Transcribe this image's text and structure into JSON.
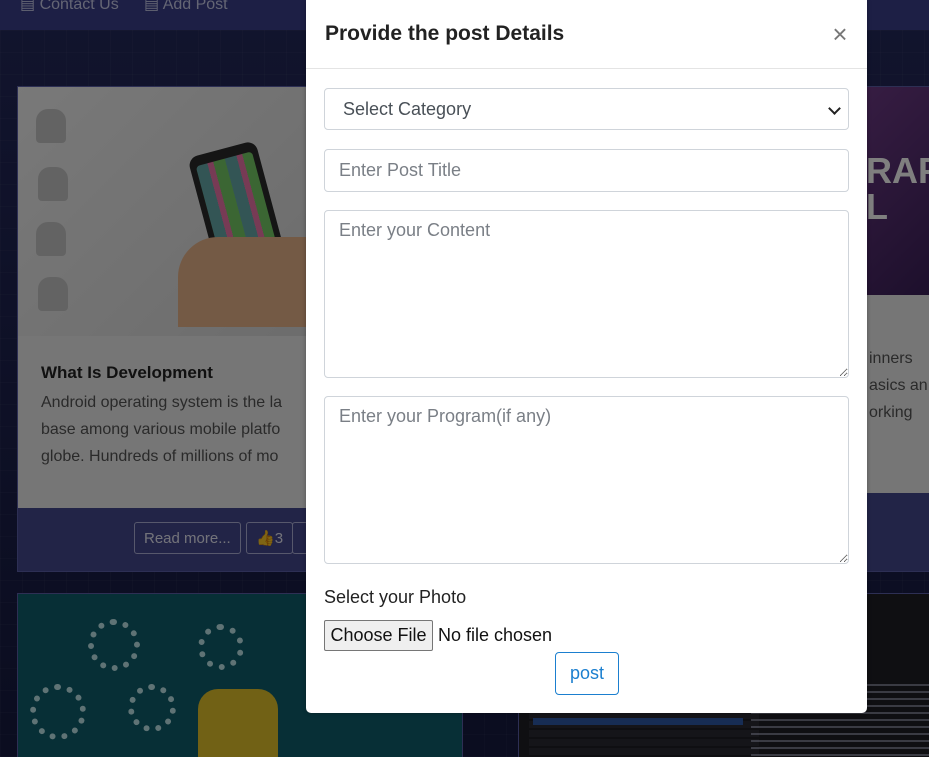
{
  "nav": {
    "contact": "Contact Us",
    "add_post": "Add Post"
  },
  "cards": {
    "card1": {
      "title": "What Is Development",
      "text": "Android operating system is the la\nbase among various mobile platfo\nglobe. Hundreds of millions of mo",
      "read_more": "Read more...",
      "likes": "3"
    },
    "card2": {
      "image_text": "RAP\nL",
      "text": "inners\nasics an\norking"
    }
  },
  "modal": {
    "title": "Provide the post Details",
    "close": "×",
    "category_select": "Select Category",
    "title_placeholder": "Enter Post Title",
    "content_placeholder": "Enter your Content",
    "program_placeholder": "Enter your Program(if any)",
    "photo_label": "Select your Photo",
    "choose_file": "Choose File",
    "file_status": "No file chosen",
    "post": "post"
  }
}
